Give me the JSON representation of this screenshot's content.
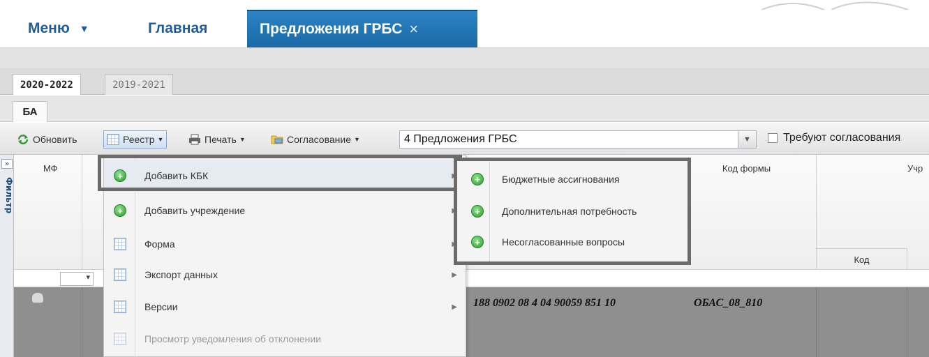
{
  "nav": {
    "menu_label": "Меню",
    "home_label": "Главная",
    "active_tab_label": "Предложения ГРБС",
    "close_glyph": "×"
  },
  "year_tabs": [
    {
      "label": "2020-2022",
      "active": true
    },
    {
      "label": "2019-2021",
      "active": false
    }
  ],
  "section_tab": {
    "label": "БА"
  },
  "toolbar": {
    "refresh_label": "Обновить",
    "registry_label": "Реестр",
    "print_label": "Печать",
    "agree_label": "Согласование",
    "combo_value": "4 Предложения ГРБС",
    "checkbox_label": "Требуют согласования"
  },
  "sidebar": {
    "toggle_glyph": "»",
    "label": "Фильтр"
  },
  "grid": {
    "headers": {
      "mf": "МФ",
      "form_code": "Код формы",
      "institution": "Учр",
      "code": "Код"
    },
    "row": {
      "kbk": "188 0902 08 4 04 90059 851 10",
      "form_code": "ОБАС_08_810"
    }
  },
  "context_menu": {
    "items": [
      {
        "label": "Добавить КБК",
        "icon": "add-green-icon",
        "has_submenu": true,
        "disabled": false
      },
      {
        "label": "Добавить учреждение",
        "icon": "add-green-icon",
        "has_submenu": true,
        "disabled": false
      },
      {
        "label": "Форма",
        "icon": "grid-icon",
        "has_submenu": true,
        "disabled": false
      },
      {
        "label": "Экспорт данных",
        "icon": "grid-icon",
        "has_submenu": true,
        "disabled": false
      },
      {
        "label": "Версии",
        "icon": "grid-icon",
        "has_submenu": true,
        "disabled": false
      },
      {
        "label": "Просмотр уведомления об отклонении",
        "icon": "grid-icon",
        "has_submenu": false,
        "disabled": true
      }
    ],
    "submenu_items": [
      {
        "label": "Бюджетные ассигнования",
        "icon": "add-green-icon"
      },
      {
        "label": "Дополнительная потребность",
        "icon": "add-green-icon"
      },
      {
        "label": "Несогласованные вопросы",
        "icon": "add-green-icon"
      }
    ]
  },
  "colors": {
    "nav_text": "#1f5c99",
    "active_tab_bg": "#1a6aa6",
    "highlight_frame": "#6b6b6b",
    "data_row_bg": "#8f8f8f",
    "icon_green": "#2e9e2e"
  }
}
